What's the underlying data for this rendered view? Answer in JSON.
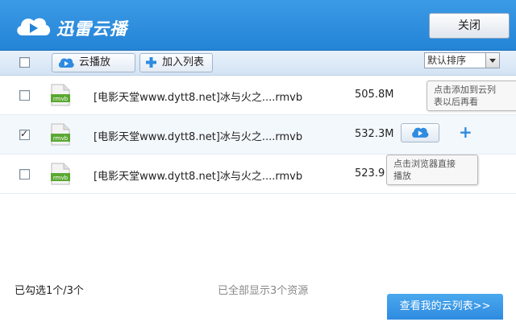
{
  "header": {
    "app_title": "迅雷云播",
    "close_label": "关闭"
  },
  "toolbar": {
    "play_label": "云播放",
    "add_label": "加入列表",
    "sort_selected": "默认排序"
  },
  "files": [
    {
      "name": "[电影天堂www.dytt8.net]冰与火之....rmvb",
      "size": "505.8M",
      "checked": false,
      "icon_text": "rmvb"
    },
    {
      "name": "[电影天堂www.dytt8.net]冰与火之....rmvb",
      "size": "532.3M",
      "checked": true,
      "icon_text": "rmvb"
    },
    {
      "name": "[电影天堂www.dytt8.net]冰与火之....rmvb",
      "size": "523.9",
      "checked": false,
      "icon_text": "rmvb"
    }
  ],
  "tooltips": {
    "add_tip_line1": "点击添加到云列",
    "add_tip_line2": "表以后再看",
    "play_tip_line1": "点击浏览器直接",
    "play_tip_line2": "播放"
  },
  "footer": {
    "selected_count": "已勾选1个/3个",
    "shown_all": "已全部显示3个资源",
    "view_list_label": "查看我的云列表>>"
  },
  "colors": {
    "accent": "#2f8be0",
    "header": "#2383d6",
    "file_icon": "#5aa832"
  }
}
